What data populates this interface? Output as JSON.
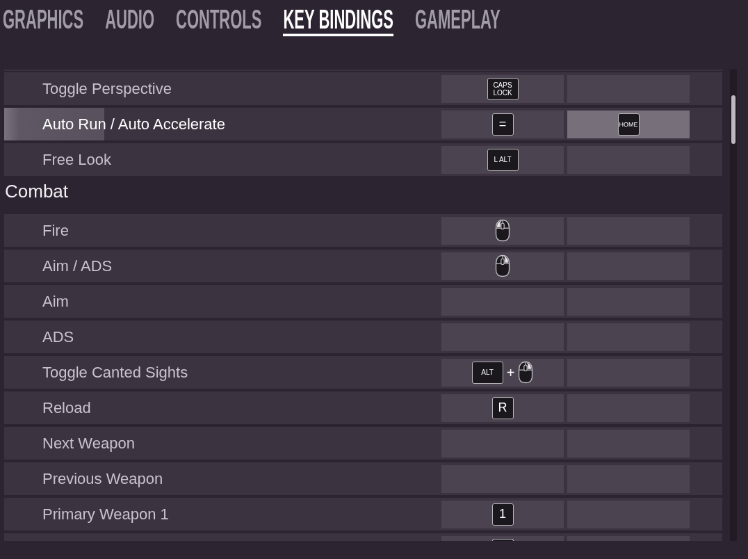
{
  "tabs": [
    {
      "label": "GRAPHICS",
      "selected": false
    },
    {
      "label": "AUDIO",
      "selected": false
    },
    {
      "label": "CONTROLS",
      "selected": false
    },
    {
      "label": "KEY BINDINGS",
      "selected": true
    },
    {
      "label": "GAMEPLAY",
      "selected": false
    }
  ],
  "sections": [
    {
      "rows": [
        {
          "kind": "full",
          "label": "Toggle Perspective",
          "selected": false,
          "bindings": [
            {
              "kind": "wide_key",
              "label": "CAPS LOCK",
              "selected": false
            },
            {
              "kind": "empty",
              "selected": false
            }
          ]
        },
        {
          "kind": "full",
          "label": "Auto Run / Auto Accelerate",
          "selected": true,
          "bindings": [
            {
              "kind": "key",
              "label": "=",
              "selected": false
            },
            {
              "kind": "small_key",
              "label": "HOME",
              "selected": true
            }
          ]
        },
        {
          "kind": "full",
          "label": "Free Look",
          "selected": false,
          "bindings": [
            {
              "kind": "wide_key",
              "label": "L ALT",
              "selected": false
            },
            {
              "kind": "empty",
              "selected": false
            }
          ]
        }
      ]
    },
    {
      "title": "Combat",
      "rows": [
        {
          "kind": "full",
          "label": "Fire",
          "selected": false,
          "bindings": [
            {
              "kind": "mouse_left",
              "selected": false
            },
            {
              "kind": "empty",
              "selected": false
            }
          ]
        },
        {
          "kind": "full",
          "label": "Aim / ADS",
          "selected": false,
          "bindings": [
            {
              "kind": "mouse_right",
              "selected": false
            },
            {
              "kind": "empty",
              "selected": false
            }
          ]
        },
        {
          "kind": "full",
          "label": "Aim",
          "selected": false,
          "bindings": [
            {
              "kind": "empty",
              "selected": false
            },
            {
              "kind": "empty",
              "selected": false
            }
          ]
        },
        {
          "kind": "full",
          "label": "ADS",
          "selected": false,
          "bindings": [
            {
              "kind": "empty",
              "selected": false
            },
            {
              "kind": "empty",
              "selected": false
            }
          ]
        },
        {
          "kind": "full",
          "label": "Toggle Canted Sights",
          "selected": false,
          "bindings": [
            {
              "kind": "combo",
              "joiner": "+",
              "selected": false,
              "keys": [
                {
                  "kind": "wide_key",
                  "label": "ALT"
                },
                {
                  "kind": "mouse_right"
                }
              ]
            },
            {
              "kind": "empty",
              "selected": false
            }
          ]
        },
        {
          "kind": "full",
          "label": "Reload",
          "selected": false,
          "bindings": [
            {
              "kind": "key",
              "label": "R",
              "selected": false
            },
            {
              "kind": "empty",
              "selected": false
            }
          ]
        },
        {
          "kind": "full",
          "label": "Next Weapon",
          "selected": false,
          "bindings": [
            {
              "kind": "empty",
              "selected": false
            },
            {
              "kind": "empty",
              "selected": false
            }
          ]
        },
        {
          "kind": "full",
          "label": "Previous Weapon",
          "selected": false,
          "bindings": [
            {
              "kind": "empty",
              "selected": false
            },
            {
              "kind": "empty",
              "selected": false
            }
          ]
        },
        {
          "kind": "full",
          "label": "Primary Weapon 1",
          "selected": false,
          "bindings": [
            {
              "kind": "key",
              "label": "1",
              "selected": false
            },
            {
              "kind": "empty",
              "selected": false
            }
          ]
        },
        {
          "kind": "partial",
          "selected": false,
          "bindings": [
            {
              "kind": "key",
              "selected": false
            },
            {
              "kind": "empty",
              "selected": false
            }
          ]
        }
      ]
    }
  ]
}
